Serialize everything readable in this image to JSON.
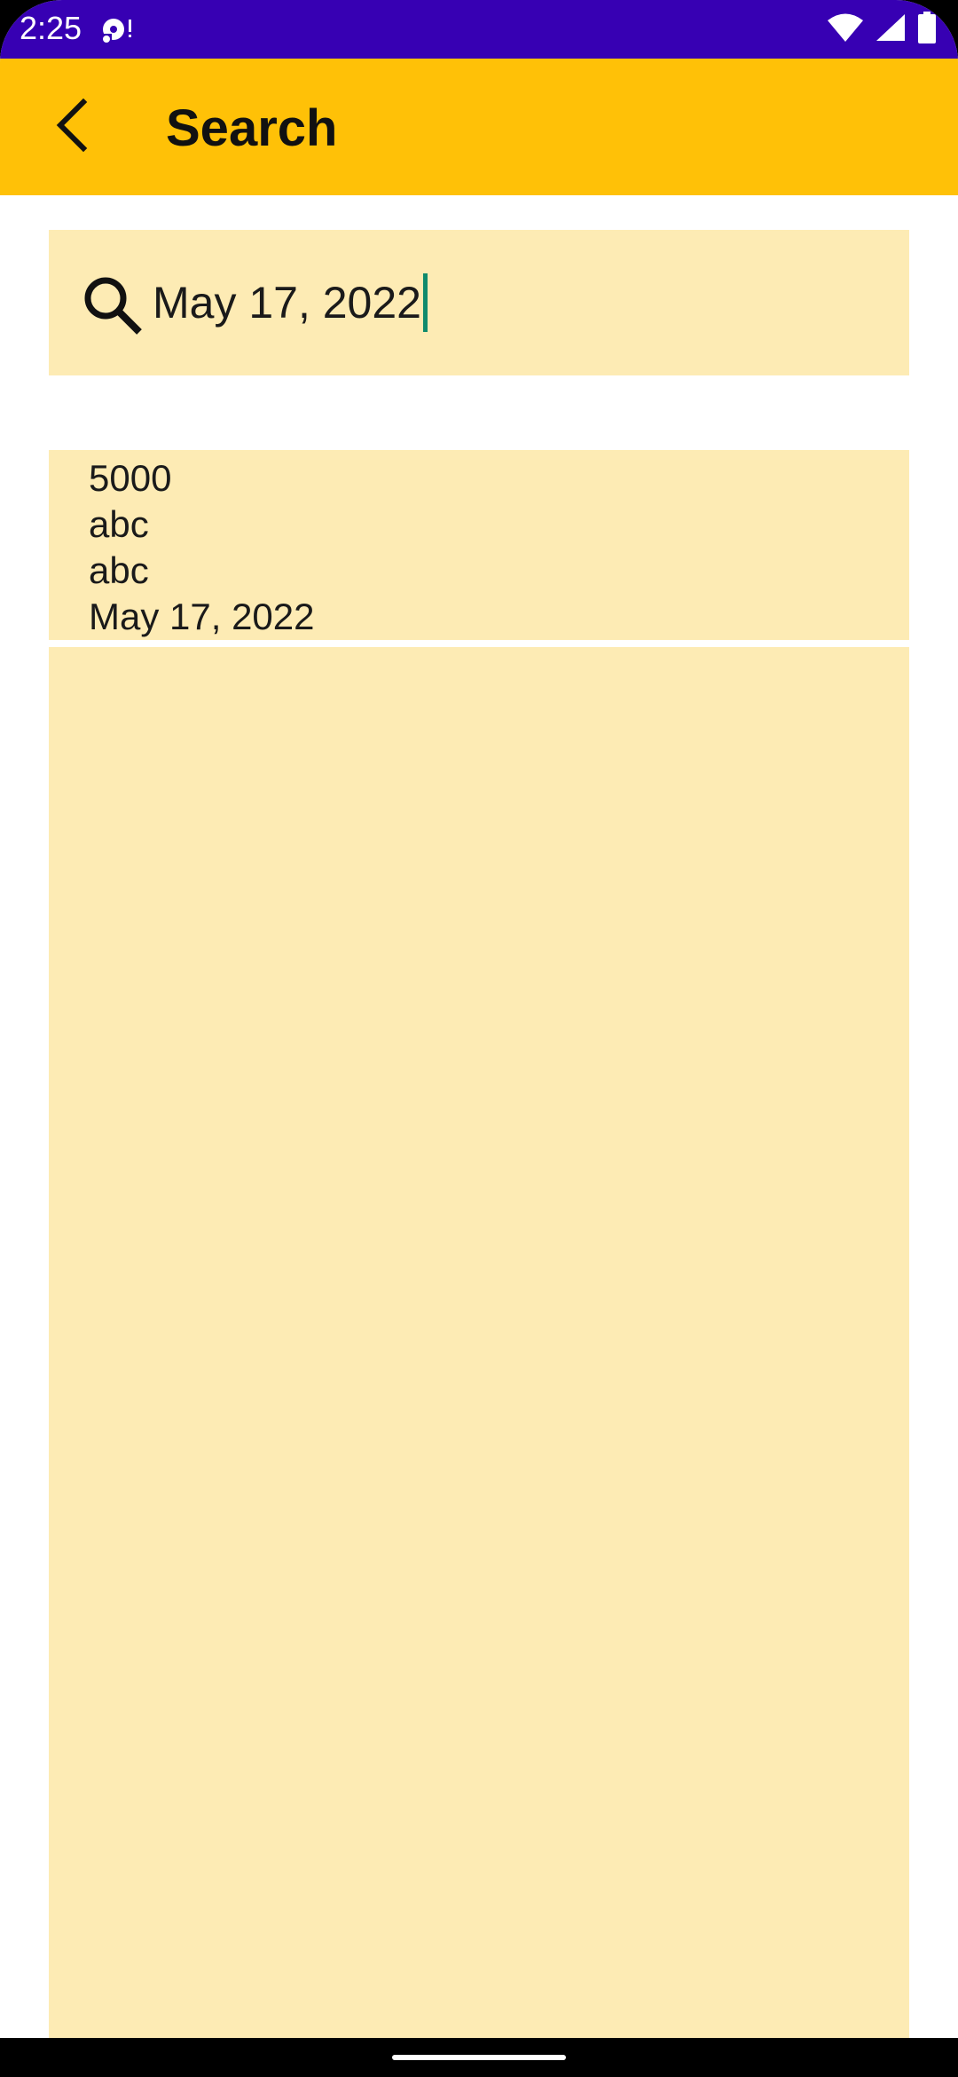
{
  "status_bar": {
    "time": "2:25",
    "notification_icon": "media-icon",
    "wifi_icon": "wifi-icon",
    "signal_icon": "signal-icon",
    "battery_icon": "battery-icon"
  },
  "app_bar": {
    "title": "Search",
    "back_icon": "back-arrow-icon"
  },
  "search": {
    "value": "May 17, 2022",
    "icon": "search-icon"
  },
  "results": [
    {
      "amount": "5000",
      "field1": "abc",
      "field2": "abc",
      "date": "May 17, 2022"
    }
  ],
  "colors": {
    "status_bar": "#3700b3",
    "app_bar": "#ffc107",
    "card_background": "#fdebb4",
    "caret": "#0f8a6c"
  }
}
